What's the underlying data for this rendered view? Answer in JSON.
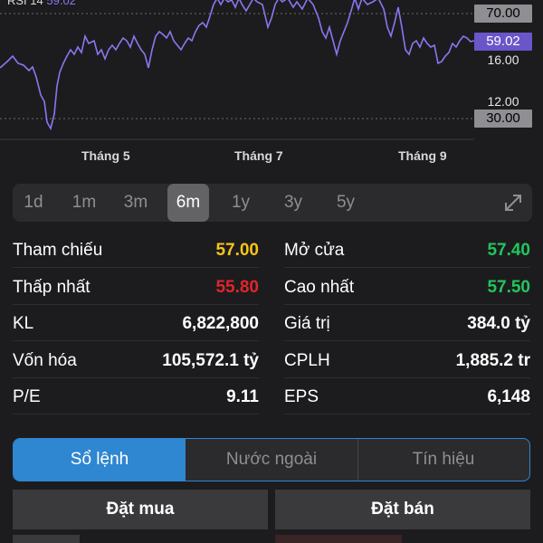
{
  "rsi": {
    "title_prefix": "RSI 14",
    "title_value": "59.02",
    "line_color": "#8b76f2",
    "axis": {
      "level_70": "70.00",
      "current": "59.02",
      "price_16": "16.00",
      "price_12": "12.00",
      "level_30": "30.00"
    },
    "months": [
      "Tháng 5",
      "Tháng 7",
      "Tháng 9"
    ]
  },
  "ranges": {
    "items": [
      "1d",
      "1m",
      "3m",
      "6m",
      "1y",
      "3y",
      "5y"
    ],
    "active": "6m",
    "expand_icon": "expand-icon"
  },
  "stats": {
    "left": [
      {
        "label": "Tham chiếu",
        "value": "57.00",
        "color": "#f5c518"
      },
      {
        "label": "Thấp nhất",
        "value": "55.80",
        "color": "#e0252c"
      },
      {
        "label": "KL",
        "value": "6,822,800",
        "color": "#ffffff"
      },
      {
        "label": "Vốn hóa",
        "value": "105,572.1 tỷ",
        "color": "#ffffff"
      },
      {
        "label": "P/E",
        "value": "9.11",
        "color": "#ffffff"
      }
    ],
    "right": [
      {
        "label": "Mở cửa",
        "value": "57.40",
        "color": "#22c55e"
      },
      {
        "label": "Cao nhất",
        "value": "57.50",
        "color": "#22c55e"
      },
      {
        "label": "Giá trị",
        "value": "384.0 tỷ",
        "color": "#ffffff"
      },
      {
        "label": "CPLH",
        "value": "1,885.2 tr",
        "color": "#ffffff"
      },
      {
        "label": "EPS",
        "value": "6,148",
        "color": "#ffffff"
      }
    ]
  },
  "main_tabs": {
    "items": [
      "Sổ lệnh",
      "Nước ngoài",
      "Tín hiệu"
    ],
    "active": "Sổ lệnh"
  },
  "orders": {
    "buy_label": "Đặt mua",
    "sell_label": "Đặt bán"
  }
}
